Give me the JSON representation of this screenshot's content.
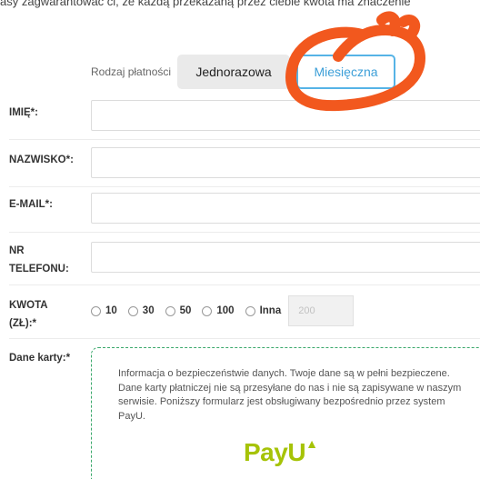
{
  "header": {
    "cut_text": "asy zagwarantować ci, że każdą przekazaną przez ciebie kwota ma znaczenie"
  },
  "payment_type": {
    "label": "Rodzaj płatności",
    "one_time": "Jednorazowa",
    "monthly": "Miesięczna",
    "selected": "Miesięczna"
  },
  "form": {
    "name_label": "IMIĘ*:",
    "surname_label": "NAZWISKO*:",
    "email_label": "E-MAIL*:",
    "phone_label_1": "NR",
    "phone_label_2": "TELEFONU:",
    "amount_label_1": "KWOTA",
    "amount_label_2": "(ZŁ):*",
    "amounts": [
      "10",
      "30",
      "50",
      "100",
      "Inna"
    ],
    "other_amount_placeholder": "200",
    "card_label": "Dane karty:*"
  },
  "card": {
    "info": "Informacja o bezpieczeństwie danych. Twoje dane są w pełni bezpieczene. Dane karty płatniczej nie są przesyłane do nas i nie są zapisywane w naszym serwisie. Poniższy formularz jest obsługiwany bezpośrednio przez system PayU.",
    "logo_text": "PayU"
  },
  "colors": {
    "accent": "#56b3e6",
    "scribble": "#f2581e",
    "payu_green": "#a6c307"
  }
}
